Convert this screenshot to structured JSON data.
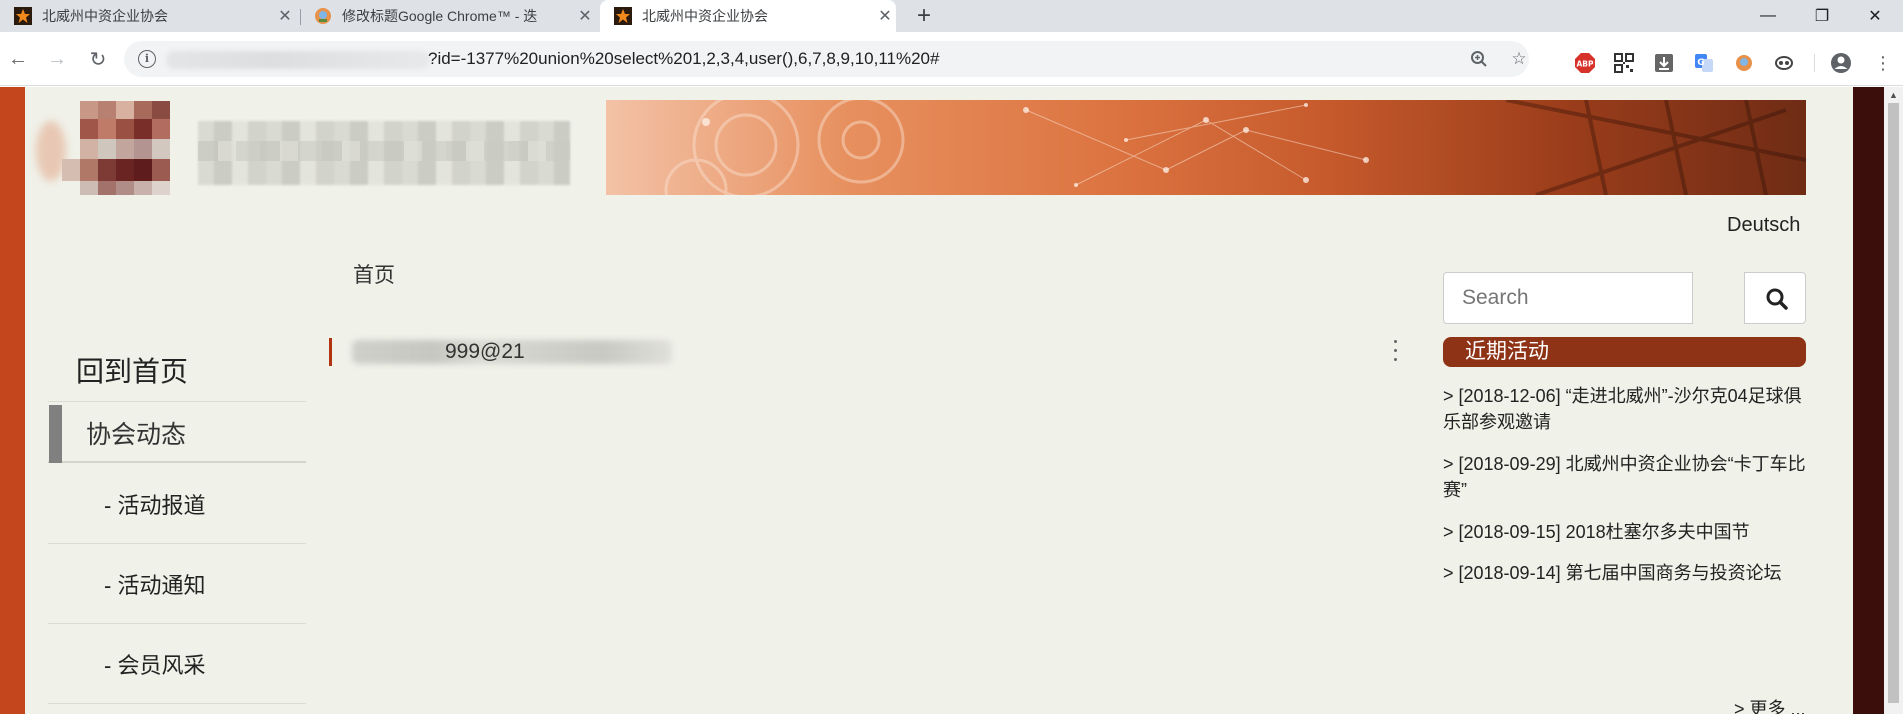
{
  "browser": {
    "tabs": [
      {
        "title": "北威州中资企业协会",
        "active": false
      },
      {
        "title": "修改标题Google Chrome™ - 迭",
        "active": false
      },
      {
        "title": "北威州中资企业协会",
        "active": true
      }
    ],
    "url_visible": "?id=-1377%20union%20select%201,2,3,4,user(),6,7,8,9,10,11%20#",
    "colors": {
      "tabbar": "#dee1e6",
      "omnibox": "#f1f3f4"
    }
  },
  "site": {
    "colors": {
      "page_bg": "#f0f1e9",
      "accent": "#8e3316",
      "frame_left": "#c4461d",
      "frame_right": "#3b0d0b"
    },
    "language_link": "Deutsch",
    "breadcrumb": "首页",
    "search": {
      "placeholder": "Search",
      "icon": "search-icon"
    },
    "left_nav": {
      "home": "回到首页",
      "section": "协会动态",
      "items": [
        "- 活动报道",
        "- 活动通知",
        "- 会员风采"
      ]
    },
    "content": {
      "visible_text": "999@21"
    },
    "events": {
      "heading": "近期活动",
      "items": [
        "> [2018-12-06] “走进北威州”-沙尔克04足球俱乐部参观邀请",
        "> [2018-09-29] 北威州中资企业协会“卡丁车比赛”",
        "> [2018-09-15] 2018杜塞尔多夫中国节",
        "> [2018-09-14] 第七届中国商务与投资论坛"
      ],
      "more": "> 更多 ..."
    }
  }
}
